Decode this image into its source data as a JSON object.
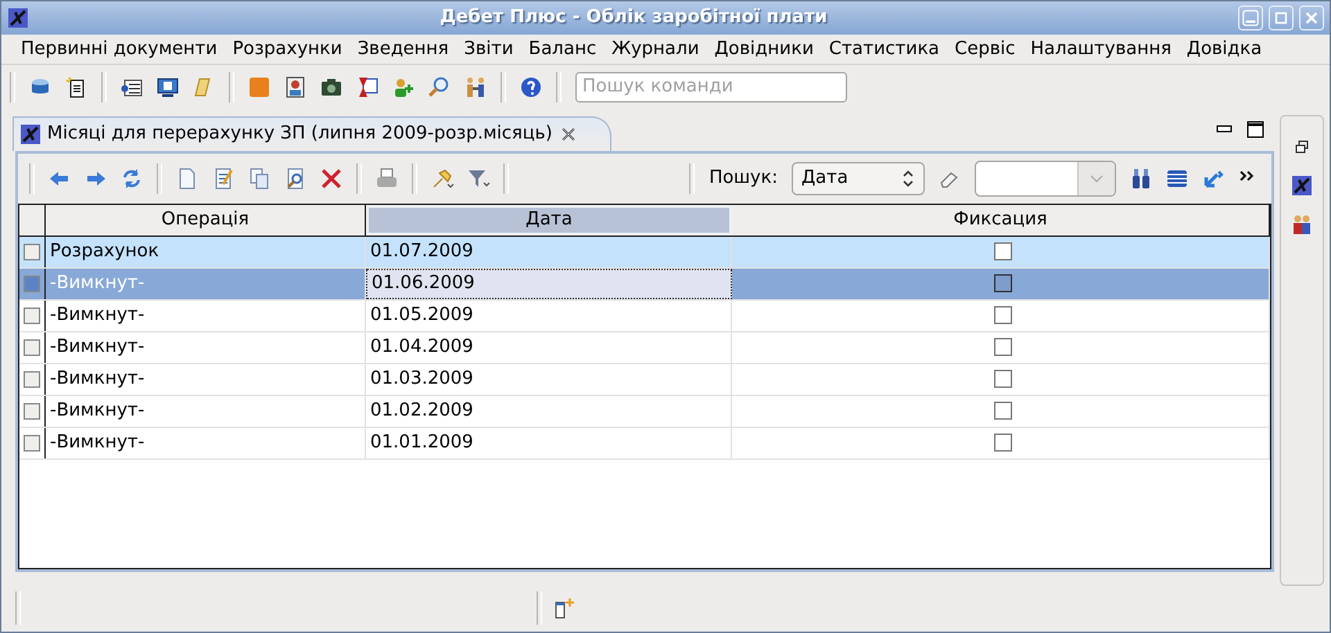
{
  "window": {
    "title": "Дебет Плюс - Облік заробітної плати"
  },
  "menu": [
    {
      "label": "Первинні документи"
    },
    {
      "label": "Розрахунки"
    },
    {
      "label": "Зведення"
    },
    {
      "label": "Звіти"
    },
    {
      "label": "Баланс"
    },
    {
      "label": "Журнали"
    },
    {
      "label": "Довідники"
    },
    {
      "label": "Статистика"
    },
    {
      "label": "Сервіс"
    },
    {
      "label": "Налаштування"
    },
    {
      "label": "Довідка"
    }
  ],
  "command_search": {
    "placeholder": "Пошук команди"
  },
  "tab": {
    "title": "Місяці для перерахунку ЗП (липня 2009-розр.місяць)",
    "selected": true
  },
  "search": {
    "label": "Пошук:",
    "field": "Дата"
  },
  "table": {
    "columns": [
      {
        "label": "Операція",
        "sorted": false
      },
      {
        "label": "Дата",
        "sorted": true
      },
      {
        "label": "Фиксация",
        "sorted": false
      }
    ],
    "rows": [
      {
        "operation": "Розрахунок",
        "date": "01.07.2009",
        "fixed": false,
        "selected": false,
        "current": true
      },
      {
        "operation": "-Вимкнут-",
        "date": "01.06.2009",
        "fixed": false,
        "selected": true,
        "current": false
      },
      {
        "operation": "-Вимкнут-",
        "date": "01.05.2009",
        "fixed": false,
        "selected": false,
        "current": false
      },
      {
        "operation": "-Вимкнут-",
        "date": "01.04.2009",
        "fixed": false,
        "selected": false,
        "current": false
      },
      {
        "operation": "-Вимкнут-",
        "date": "01.03.2009",
        "fixed": false,
        "selected": false,
        "current": false
      },
      {
        "operation": "-Вимкнут-",
        "date": "01.02.2009",
        "fixed": false,
        "selected": false,
        "current": false
      },
      {
        "operation": "-Вимкнут-",
        "date": "01.01.2009",
        "fixed": false,
        "selected": false,
        "current": false
      }
    ]
  }
}
